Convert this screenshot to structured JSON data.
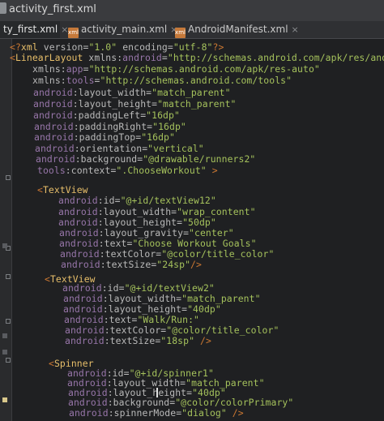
{
  "window": {
    "title": "activity_first.xml"
  },
  "tabs": [
    {
      "label": "ty_first.xml",
      "close": "×"
    },
    {
      "label": "activity_main.xml",
      "close": "×"
    },
    {
      "label": "AndroidManifest.xml",
      "close": "×"
    }
  ],
  "code": {
    "lines": [
      [
        {
          "c": "punct",
          "t": "<?"
        },
        {
          "c": "tag",
          "t": "xml "
        },
        {
          "c": "attr",
          "t": "version="
        },
        {
          "c": "val",
          "t": "\"1.0\""
        },
        {
          "c": "attr",
          "t": " encoding="
        },
        {
          "c": "val",
          "t": "\"utf-8\""
        },
        {
          "c": "punct",
          "t": "?>"
        }
      ],
      [
        {
          "c": "punct",
          "t": "<"
        },
        {
          "c": "tag",
          "t": "LinearLayout "
        },
        {
          "c": "attr",
          "t": "xmlns:"
        },
        {
          "c": "ns",
          "t": "android"
        },
        {
          "c": "attr",
          "t": "="
        },
        {
          "c": "val",
          "t": "\"http://schemas.android.com/apk/res/android\""
        }
      ],
      [
        {
          "c": "attr",
          "t": "xmlns:"
        },
        {
          "c": "ns",
          "t": "app"
        },
        {
          "c": "attr",
          "t": "="
        },
        {
          "c": "val",
          "t": "\"http://schemas.android.com/apk/res-auto\""
        }
      ],
      [
        {
          "c": "attr",
          "t": "xmlns:"
        },
        {
          "c": "ns",
          "t": "tools"
        },
        {
          "c": "attr",
          "t": "="
        },
        {
          "c": "val",
          "t": "\"http://schemas.android.com/tools\""
        }
      ],
      [
        {
          "c": "ns",
          "t": "android"
        },
        {
          "c": "attr",
          "t": ":layout_width="
        },
        {
          "c": "val",
          "t": "\"match_parent\""
        }
      ],
      [
        {
          "c": "ns",
          "t": "android"
        },
        {
          "c": "attr",
          "t": ":layout_height="
        },
        {
          "c": "val",
          "t": "\"match_parent\""
        }
      ],
      [
        {
          "c": "ns",
          "t": "android"
        },
        {
          "c": "attr",
          "t": ":paddingLeft="
        },
        {
          "c": "val",
          "t": "\"16dp\""
        }
      ],
      [
        {
          "c": "ns",
          "t": "android"
        },
        {
          "c": "attr",
          "t": ":paddingRight="
        },
        {
          "c": "val",
          "t": "\"16dp\""
        }
      ],
      [
        {
          "c": "ns",
          "t": "android"
        },
        {
          "c": "attr",
          "t": ":paddingTop="
        },
        {
          "c": "val",
          "t": "\"16dp\""
        }
      ],
      [
        {
          "c": "ns",
          "t": "android"
        },
        {
          "c": "attr",
          "t": ":orientation="
        },
        {
          "c": "val",
          "t": "\"vertical\""
        }
      ],
      [
        {
          "c": "ns",
          "t": "android"
        },
        {
          "c": "attr",
          "t": ":background="
        },
        {
          "c": "val",
          "t": "\"@drawable/runners2\""
        }
      ],
      [
        {
          "c": "ns",
          "t": "tools"
        },
        {
          "c": "attr",
          "t": ":context="
        },
        {
          "c": "val",
          "t": "\".ChooseWorkout\""
        },
        {
          "c": "punct",
          "t": " >"
        }
      ],
      [],
      [
        {
          "c": "punct",
          "t": "<"
        },
        {
          "c": "tag",
          "t": "TextView"
        }
      ],
      [
        {
          "c": "ns",
          "t": "android"
        },
        {
          "c": "attr",
          "t": ":id="
        },
        {
          "c": "val",
          "t": "\"@+id/textView12\""
        }
      ],
      [
        {
          "c": "ns",
          "t": "android"
        },
        {
          "c": "attr",
          "t": ":layout_width="
        },
        {
          "c": "val",
          "t": "\"wrap_content\""
        }
      ],
      [
        {
          "c": "ns",
          "t": "android"
        },
        {
          "c": "attr",
          "t": ":layout_height="
        },
        {
          "c": "val",
          "t": "\"50dp\""
        }
      ],
      [
        {
          "c": "ns",
          "t": "android"
        },
        {
          "c": "attr",
          "t": ":layout_gravity="
        },
        {
          "c": "val",
          "t": "\"center\""
        }
      ],
      [
        {
          "c": "ns",
          "t": "android"
        },
        {
          "c": "attr",
          "t": ":text="
        },
        {
          "c": "val",
          "t": "\"Choose Workout Goals\""
        }
      ],
      [
        {
          "c": "ns",
          "t": "android"
        },
        {
          "c": "attr",
          "t": ":textColor="
        },
        {
          "c": "val",
          "t": "\"@color/title_color\""
        }
      ],
      [
        {
          "c": "ns",
          "t": "android"
        },
        {
          "c": "attr",
          "t": ":textSize="
        },
        {
          "c": "val",
          "t": "\"24sp\""
        },
        {
          "c": "punct",
          "t": "/>"
        }
      ],
      [],
      [
        {
          "c": "punct",
          "t": "<"
        },
        {
          "c": "tag",
          "t": "TextView"
        }
      ],
      [
        {
          "c": "ns",
          "t": "android"
        },
        {
          "c": "attr",
          "t": ":id="
        },
        {
          "c": "val",
          "t": "\"@+id/textView2\""
        }
      ],
      [
        {
          "c": "ns",
          "t": "android"
        },
        {
          "c": "attr",
          "t": ":layout_width="
        },
        {
          "c": "val",
          "t": "\"match_parent\""
        }
      ],
      [
        {
          "c": "ns",
          "t": "android"
        },
        {
          "c": "attr",
          "t": ":layout_height="
        },
        {
          "c": "val",
          "t": "\"40dp\""
        }
      ],
      [
        {
          "c": "ns",
          "t": "android"
        },
        {
          "c": "attr",
          "t": ":text="
        },
        {
          "c": "val",
          "t": "\"Walk/Run:\""
        }
      ],
      [
        {
          "c": "ns",
          "t": "android"
        },
        {
          "c": "attr",
          "t": ":textColor="
        },
        {
          "c": "val",
          "t": "\"@color/title_color\""
        }
      ],
      [
        {
          "c": "ns",
          "t": "android"
        },
        {
          "c": "attr",
          "t": ":textSize="
        },
        {
          "c": "val",
          "t": "\"18sp\""
        },
        {
          "c": "punct",
          "t": " />"
        }
      ],
      [],
      [],
      [
        {
          "c": "punct",
          "t": "<"
        },
        {
          "c": "tag",
          "t": "Spinner"
        }
      ],
      [
        {
          "c": "ns",
          "t": "android"
        },
        {
          "c": "attr",
          "t": ":id="
        },
        {
          "c": "val",
          "t": "\"@+id/spinner1\""
        }
      ],
      [
        {
          "c": "ns",
          "t": "android"
        },
        {
          "c": "attr",
          "t": ":layout_width="
        },
        {
          "c": "val",
          "t": "\"match_parent\""
        }
      ],
      [
        {
          "c": "ns",
          "t": "android"
        },
        {
          "c": "attr",
          "t": ":layout_height="
        },
        {
          "c": "val",
          "t": "\"40dp\""
        }
      ],
      [
        {
          "c": "ns",
          "t": "android"
        },
        {
          "c": "attr",
          "t": ":background="
        },
        {
          "c": "val",
          "t": "\"@color/colorPrimary\""
        }
      ],
      [
        {
          "c": "ns",
          "t": "android"
        },
        {
          "c": "attr",
          "t": ":spinnerMode="
        },
        {
          "c": "val",
          "t": "\"dialog\""
        },
        {
          "c": "punct",
          "t": " />"
        }
      ]
    ]
  },
  "colors": {
    "tag": "#e8bf6a",
    "attribute": "#bababa",
    "namespace": "#9876aa",
    "value": "#a5c25c",
    "punctuation": "#cc7832",
    "background": "#1f2022"
  }
}
